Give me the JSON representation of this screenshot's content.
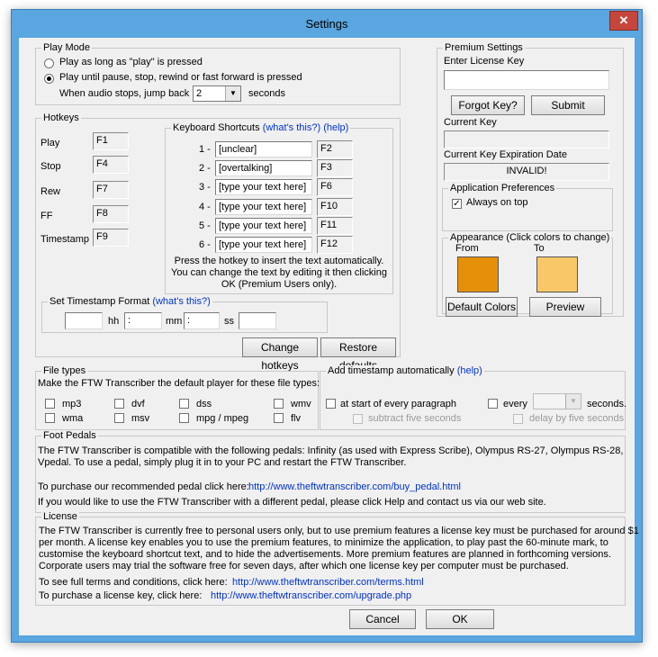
{
  "window": {
    "title": "Settings",
    "close_label": "✕"
  },
  "play_mode": {
    "legend": "Play Mode",
    "option1": "Play as long as \"play\" is pressed",
    "option2": "Play until pause, stop, rewind or fast forward is pressed",
    "jump_label": "When audio stops, jump back",
    "jump_value": "2",
    "jump_unit": "seconds",
    "selected_option": 2
  },
  "hotkeys": {
    "legend": "Hotkeys",
    "items": [
      {
        "label": "Play",
        "key": "F1"
      },
      {
        "label": "Stop",
        "key": "F4"
      },
      {
        "label": "Rew",
        "key": "F7"
      },
      {
        "label": "FF",
        "key": "F8"
      },
      {
        "label": "Timestamp",
        "key": "F9"
      }
    ]
  },
  "shortcuts": {
    "legend": "Keyboard Shortcuts",
    "whats_this": "(what's this?)",
    "help": "(help)",
    "rows": [
      {
        "num": "1 -",
        "text": "[unclear]",
        "key": "F2"
      },
      {
        "num": "2 -",
        "text": "[overtalking]",
        "key": "F3"
      },
      {
        "num": "3 -",
        "text": "[type your text here]",
        "key": "F6"
      },
      {
        "num": "4 -",
        "text": "[type your text here]",
        "key": "F10"
      },
      {
        "num": "5 -",
        "text": "[type your text here]",
        "key": "F11"
      },
      {
        "num": "6 -",
        "text": "[type your text here]",
        "key": "F12"
      }
    ],
    "note1": "Press the hotkey to insert the text automatically.",
    "note2": "You can change the text by editing it then clicking",
    "note3": "OK (Premium Users only)."
  },
  "timestamp_format": {
    "legend": "Set Timestamp Format",
    "whats_this": "(what's this?)",
    "hh": "hh",
    "mm": "mm",
    "ss": "ss",
    "sep1": ":",
    "sep2": ":"
  },
  "buttons": {
    "change_hotkeys": "Change hotkeys",
    "restore_defaults": "Restore defaults",
    "cancel": "Cancel",
    "ok": "OK"
  },
  "premium": {
    "legend": "Premium Settings",
    "license_label": "Enter License Key",
    "forgot_key": "Forgot Key?",
    "submit": "Submit",
    "current_key_label": "Current Key",
    "expiration_label": "Current Key Expiration Date",
    "expiration_value": "INVALID!"
  },
  "app_prefs": {
    "legend": "Application Preferences",
    "always_on_top": "Always on top",
    "always_on_top_checked": true
  },
  "appearance": {
    "legend": "Appearance (Click colors to change)",
    "from_label": "From",
    "to_label": "To",
    "from_color": "#e6900a",
    "to_color": "#f7c768",
    "default_colors": "Default Colors",
    "preview": "Preview"
  },
  "file_types": {
    "legend": "File types",
    "description": "Make the FTW Transcriber the default player for these file types:",
    "types": [
      "mp3",
      "dvf",
      "dss",
      "wmv",
      "wma",
      "msv",
      "mpg / mpeg",
      "flv"
    ]
  },
  "add_timestamp": {
    "legend": "Add timestamp automatically",
    "help": "(help)",
    "at_start": "at start of every paragraph",
    "every": "every",
    "seconds": "seconds.",
    "subtract": "subtract five seconds",
    "delay": "delay by five seconds"
  },
  "foot_pedals": {
    "legend": "Foot Pedals",
    "line1": "The FTW Transcriber is compatible with the following pedals: Infinity (as used with Express Scribe), Olympus RS-27, Olympus RS-28,",
    "line2": "Vpedal.  To use a pedal, simply plug it in to your PC and restart the FTW Transcriber.",
    "purchase_label": "To purchase our recommended pedal click here:",
    "purchase_link": "http://www.theftwtranscriber.com/buy_pedal.html",
    "different_pedal": "If you would like to use the FTW Transcriber with a different pedal, please click Help and contact us via our web site."
  },
  "license": {
    "legend": "License",
    "line1": "The FTW Transcriber is currently free to personal users only, but to use premium features a license key must be purchased for around $1",
    "line2": "per month.  A license key enables you to use the premium features, to minimize the application, to play past the 60-minute mark, to",
    "line3": "customise the keyboard shortcut text, and to hide the advertisements.  More premium features are planned in forthcoming versions.",
    "line4": "Corporate users may trial the software free for seven days, after which one license key per computer must be purchased.",
    "terms_label": "To see full terms and conditions, click here:",
    "terms_link": "http://www.theftwtranscriber.com/terms.html",
    "purchase_label": "To purchase a license key, click here:",
    "purchase_link": "http://www.theftwtranscriber.com/upgrade.php"
  }
}
